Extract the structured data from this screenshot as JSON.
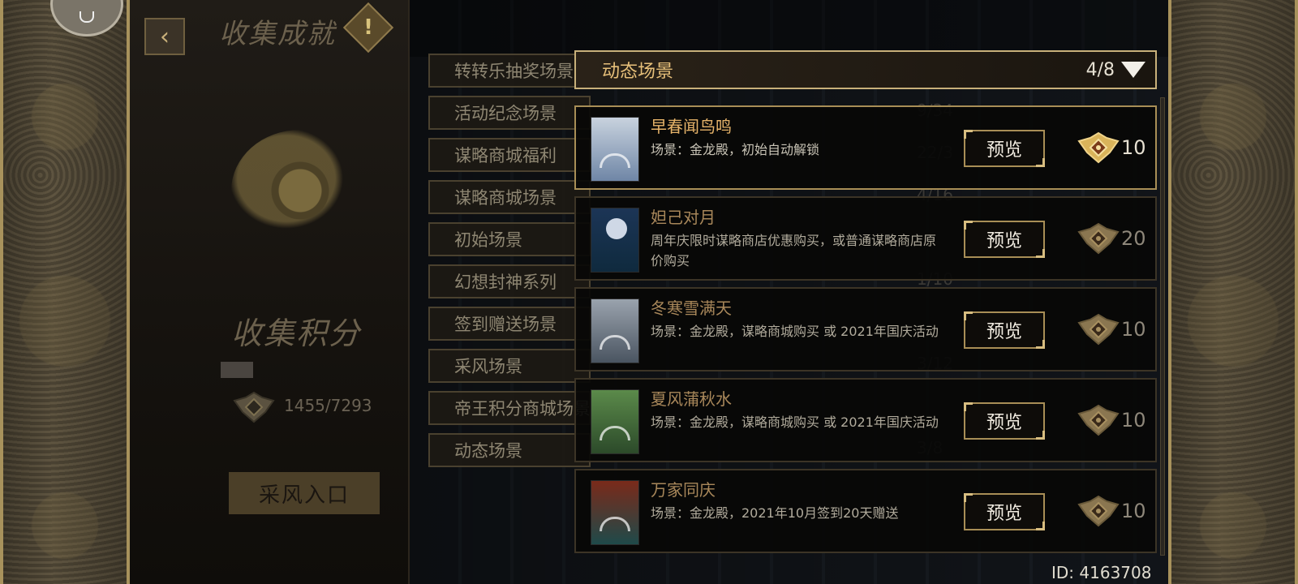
{
  "header": {
    "page_title": "收集成就",
    "back_icon": "chevron-left-icon",
    "warn_symbol": "!"
  },
  "left_panel": {
    "score_title": "收集积分",
    "score_value": "1455/7293",
    "sample_button": "采风入口"
  },
  "categories": [
    "转转乐抽奖场景",
    "活动纪念场景",
    "谋略商城福利",
    "谋略商城场景",
    "初始场景",
    "幻想封神系列",
    "签到赠送场景",
    "采风场景",
    "帝王积分商城场景",
    "动态场景"
  ],
  "background_counts": [
    "24/83",
    "9/34",
    "22/3",
    "4/16",
    "1/10",
    "3/12",
    "3/8"
  ],
  "dropdown": {
    "title": "动态场景",
    "count": "4/8"
  },
  "scenes": [
    {
      "title": "早春闻鸟鸣",
      "desc": "场景：金龙殿，初始自动解锁",
      "button": "预览",
      "reward": "10",
      "unlocked": true,
      "thumb_colors": [
        "#c8d2de",
        "#6f86a6"
      ]
    },
    {
      "title": "妲己对月",
      "desc": "周年庆限时谋略商店优惠购买，或普通谋略商店原价购买",
      "button": "预览",
      "reward": "20",
      "unlocked": false,
      "thumb_colors": [
        "#1c3556",
        "#0f2a3e"
      ]
    },
    {
      "title": "冬寒雪满天",
      "desc": "场景：金龙殿，谋略商城购买 或 2021年国庆活动",
      "button": "预览",
      "reward": "10",
      "unlocked": false,
      "thumb_colors": [
        "#9aa3ad",
        "#4a5561"
      ]
    },
    {
      "title": "夏风蒲秋水",
      "desc": "场景：金龙殿，谋略商城购买 或 2021年国庆活动",
      "button": "预览",
      "reward": "10",
      "unlocked": false,
      "thumb_colors": [
        "#5b8a4a",
        "#2c4a2a"
      ]
    },
    {
      "title": "万家同庆",
      "desc": "场景：金龙殿，2021年10月签到20天赠送",
      "button": "预览",
      "reward": "10",
      "unlocked": false,
      "thumb_colors": [
        "#7a2a1a",
        "#1f4a4a"
      ]
    }
  ],
  "footer": {
    "id_label": "ID: 4163708"
  },
  "colors": {
    "accent_gold": "#e7b46a",
    "frame_gold": "#c8b07a"
  }
}
